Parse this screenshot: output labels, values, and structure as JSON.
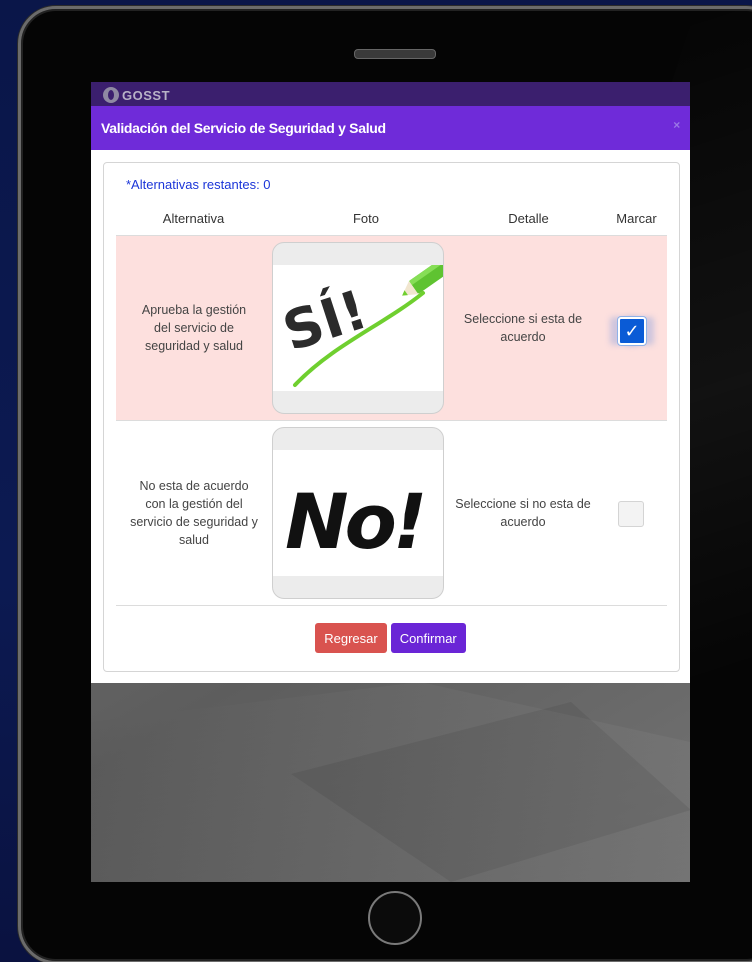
{
  "app": {
    "logo_text": "GOSST"
  },
  "modal": {
    "title": "Validación del Servicio de Seguridad y Salud",
    "close_glyph": "×",
    "remaining_label": "*Alternativas restantes: 0",
    "columns": [
      "Alternativa",
      "Foto",
      "Detalle",
      "Marcar"
    ],
    "rows": [
      {
        "alternative": "Aprueba la gestión del servicio de seguridad y salud",
        "photo_text": "SÍ!",
        "detail": "Seleccione si esta de acuerdo",
        "checked": true,
        "highlight_color": "#fde0de"
      },
      {
        "alternative": "No esta de acuerdo con la gestión del servicio de seguridad y salud",
        "photo_text": "No!",
        "detail": "Seleccione si no esta de acuerdo",
        "checked": false
      }
    ],
    "buttons": {
      "back": "Regresar",
      "confirm": "Confirmar"
    }
  },
  "colors": {
    "header": "#6f2bd9",
    "confirm": "#6a25d6",
    "back": "#d9534f",
    "remaining_text": "#1b35d8",
    "checkbox": "#0a5bd6"
  },
  "icons": {
    "check": "check-icon",
    "close": "close-icon",
    "pencil": "pencil-icon"
  }
}
